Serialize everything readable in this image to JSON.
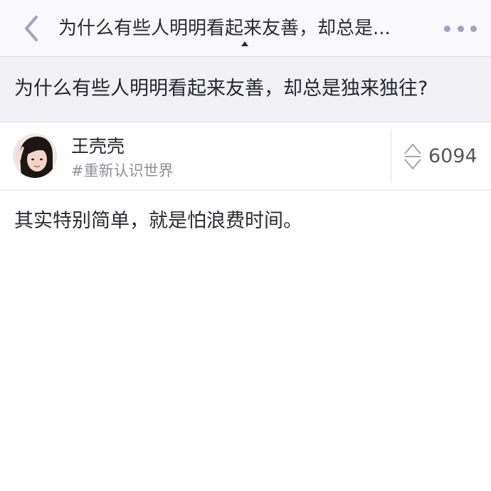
{
  "navbar": {
    "back_icon": "chevron-left-icon",
    "title": "为什么有些人明明看起来友善，却总是...",
    "more_icon": "more-dots-icon"
  },
  "question": {
    "title": "为什么有些人明明看起来友善，却总是独来独往?"
  },
  "author": {
    "name": "王壳壳",
    "bio": "#重新认识世界",
    "avatar_icon": "avatar"
  },
  "vote": {
    "icon": "vote-arrows-icon",
    "count": "6094"
  },
  "answer": {
    "text": "其实特别简单，就是怕浪费时间。"
  },
  "colors": {
    "accent": "#a3a1c0",
    "banner_bg": "#f1f1f6",
    "navbar_bg": "#f9f9fb"
  }
}
